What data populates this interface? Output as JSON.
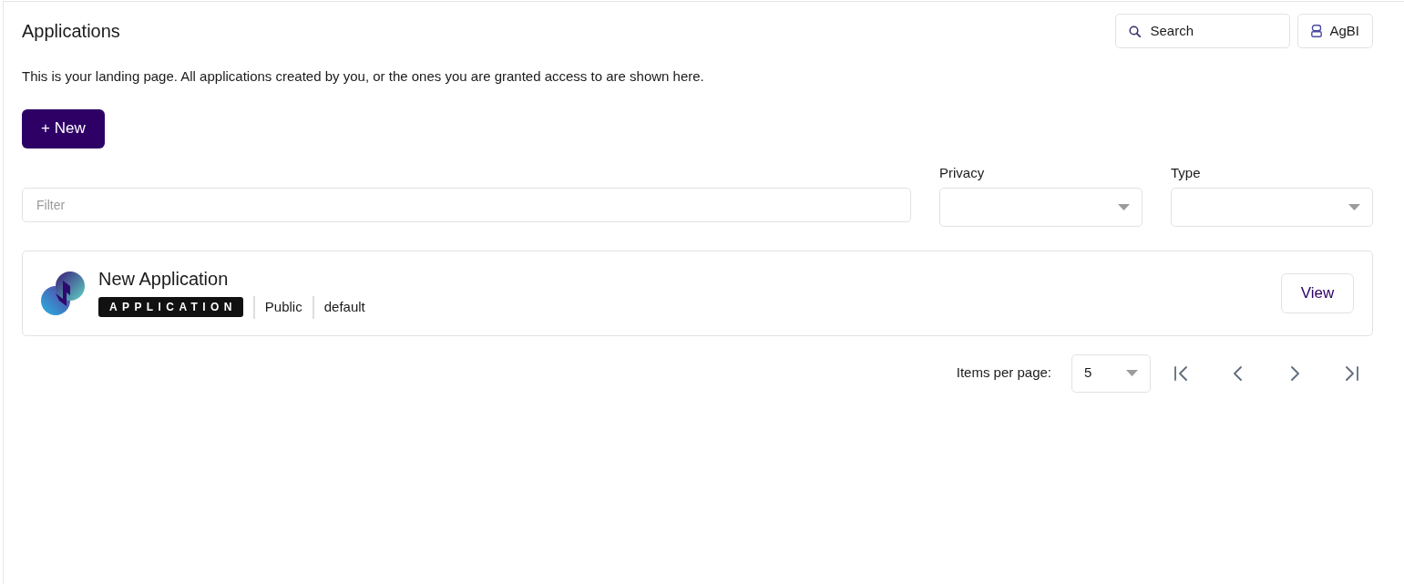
{
  "header": {
    "title": "Applications",
    "search_button": {
      "label": "Search"
    },
    "user_button": {
      "label": "AgBI"
    }
  },
  "description": "This is your landing page. All applications created by you, or the ones you are granted access to are shown here.",
  "new_button": {
    "label": "+ New"
  },
  "filters": {
    "filter_field": {
      "placeholder": "Filter"
    },
    "dropdowns": [
      {
        "label": "Privacy"
      },
      {
        "label": "Type"
      }
    ]
  },
  "applications": [
    {
      "name": "New Application",
      "badge": "APPLICATION",
      "privacy": "Public",
      "tag": "default",
      "action": "View"
    }
  ],
  "pagination": {
    "label": "Items per page:",
    "page_size": "5"
  }
}
